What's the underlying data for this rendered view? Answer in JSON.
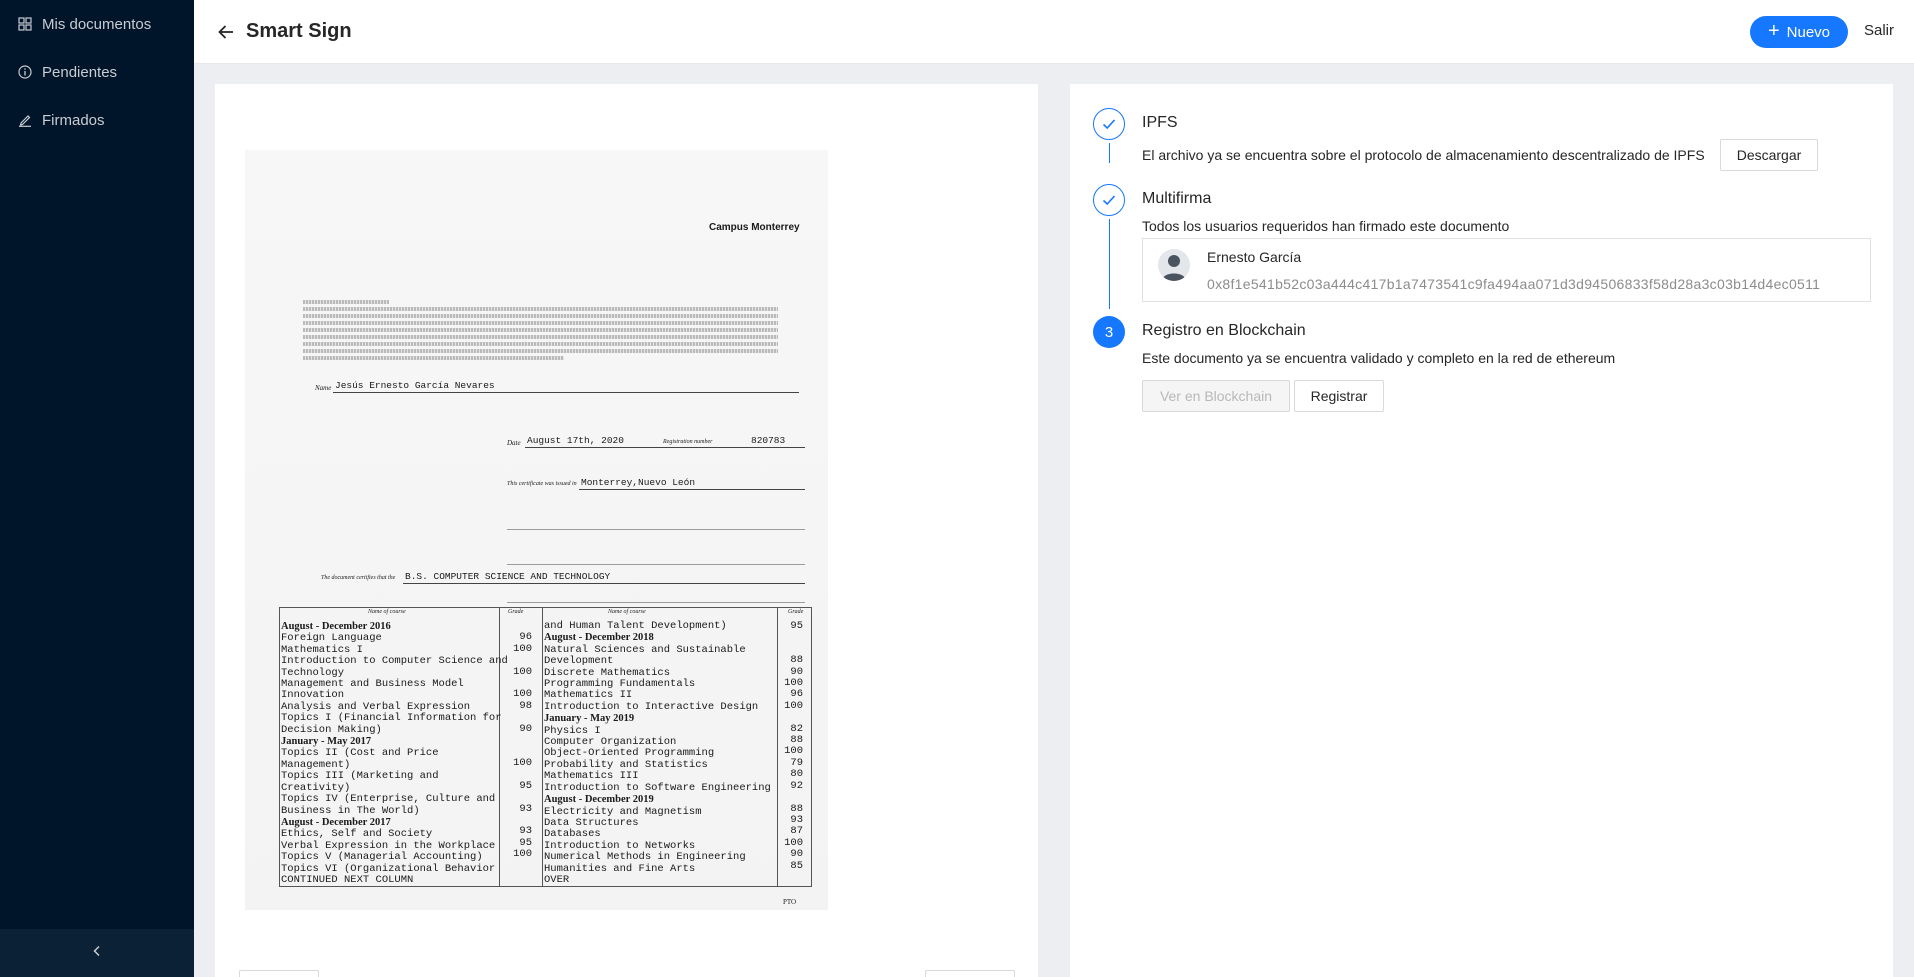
{
  "sidebar": {
    "items": [
      {
        "label": "Mis documentos",
        "icon": "grid-icon"
      },
      {
        "label": "Pendientes",
        "icon": "info-circle-icon"
      },
      {
        "label": "Firmados",
        "icon": "edit-icon"
      }
    ],
    "collapse_icon": "chevron-left-icon"
  },
  "header": {
    "title": "Smart Sign",
    "new_label": "Nuevo",
    "logout_label": "Salir"
  },
  "document": {
    "campus": "Campus Monterrey",
    "name_label": "Name",
    "name": "Jesús Ernesto García Nevares",
    "date_label": "Date",
    "date": "August 17th, 2020",
    "registration_label": "Registration number",
    "registration": "820783",
    "issued_label": "This certificate was issued in",
    "issued": "Monterrey,Nuevo León",
    "program_label": "The document certifies that the",
    "program": "B.S. COMPUTER SCIENCE AND TECHNOLOGY",
    "course_header": "Name of course",
    "grade_header": "Grade",
    "pto": "PTO",
    "left_column": [
      {
        "text": "August - December 2016",
        "grade": "",
        "term": true
      },
      {
        "text": "Foreign Language",
        "grade": "96",
        "term": false
      },
      {
        "text": "Mathematics I",
        "grade": "100",
        "term": false
      },
      {
        "text": "Introduction to Computer Science and",
        "grade": "",
        "term": false
      },
      {
        "text": "Technology",
        "grade": "100",
        "term": false
      },
      {
        "text": "Management and Business Model",
        "grade": "",
        "term": false
      },
      {
        "text": "Innovation",
        "grade": "100",
        "term": false
      },
      {
        "text": "Analysis and Verbal Expression",
        "grade": "98",
        "term": false
      },
      {
        "text": "Topics I (Financial Information for",
        "grade": "",
        "term": false
      },
      {
        "text": "Decision Making)",
        "grade": "90",
        "term": false
      },
      {
        "text": "January - May 2017",
        "grade": "",
        "term": true
      },
      {
        "text": "Topics II (Cost and Price",
        "grade": "",
        "term": false
      },
      {
        "text": "Management)",
        "grade": "100",
        "term": false
      },
      {
        "text": "Topics III (Marketing and",
        "grade": "",
        "term": false
      },
      {
        "text": "Creativity)",
        "grade": "95",
        "term": false
      },
      {
        "text": "Topics IV (Enterprise, Culture and",
        "grade": "",
        "term": false
      },
      {
        "text": "Business in The World)",
        "grade": "93",
        "term": false
      },
      {
        "text": "August - December 2017",
        "grade": "",
        "term": true
      },
      {
        "text": "Ethics, Self and Society",
        "grade": "93",
        "term": false
      },
      {
        "text": "Verbal Expression in the Workplace",
        "grade": "95",
        "term": false
      },
      {
        "text": "Topics V (Managerial Accounting)",
        "grade": "100",
        "term": false
      },
      {
        "text": "Topics VI (Organizational Behavior",
        "grade": "",
        "term": false
      },
      {
        "text": "CONTINUED NEXT COLUMN",
        "grade": "",
        "term": false
      }
    ],
    "right_column": [
      {
        "text": "and Human Talent Development)",
        "grade": "95",
        "term": false
      },
      {
        "text": "August - December 2018",
        "grade": "",
        "term": true
      },
      {
        "text": "Natural Sciences and Sustainable",
        "grade": "",
        "term": false
      },
      {
        "text": "Development",
        "grade": "88",
        "term": false
      },
      {
        "text": "Discrete Mathematics",
        "grade": "90",
        "term": false
      },
      {
        "text": "Programming Fundamentals",
        "grade": "100",
        "term": false
      },
      {
        "text": "Mathematics II",
        "grade": "96",
        "term": false
      },
      {
        "text": "Introduction to Interactive Design",
        "grade": "100",
        "term": false
      },
      {
        "text": "January - May 2019",
        "grade": "",
        "term": true
      },
      {
        "text": "Physics I",
        "grade": "82",
        "term": false
      },
      {
        "text": "Computer Organization",
        "grade": "88",
        "term": false
      },
      {
        "text": "Object-Oriented Programming",
        "grade": "100",
        "term": false
      },
      {
        "text": "Probability and Statistics",
        "grade": "79",
        "term": false
      },
      {
        "text": "Mathematics III",
        "grade": "80",
        "term": false
      },
      {
        "text": "Introduction to Software Engineering",
        "grade": "92",
        "term": false
      },
      {
        "text": "August - December 2019",
        "grade": "",
        "term": true
      },
      {
        "text": "Electricity and Magnetism",
        "grade": "88",
        "term": false
      },
      {
        "text": "Data Structures",
        "grade": "93",
        "term": false
      },
      {
        "text": "Databases",
        "grade": "87",
        "term": false
      },
      {
        "text": "Introduction to Networks",
        "grade": "100",
        "term": false
      },
      {
        "text": "Numerical Methods in Engineering",
        "grade": "90",
        "term": false
      },
      {
        "text": "Humanities and Fine Arts",
        "grade": "85",
        "term": false
      },
      {
        "text": "OVER",
        "grade": "",
        "term": false
      }
    ]
  },
  "steps": [
    {
      "title": "IPFS",
      "description": "El archivo ya se encuentra sobre el protocolo de almacenamiento descentralizado de IPFS",
      "button": "Descargar",
      "status": "done"
    },
    {
      "title": "Multifirma",
      "description": "Todos los usuarios requeridos han firmado este documento",
      "status": "done",
      "signer": {
        "name": "Ernesto García",
        "address": "0x8f1e541b52c03a444c417b1a7473541c9fa494aa071d3d94506833f58d28a3c03b14d4ec0511"
      }
    },
    {
      "title": "Registro en Blockchain",
      "number": "3",
      "description": "Este documento ya se encuentra validado y completo en la red de ethereum",
      "view_button": "Ver en Blockchain",
      "register_button": "Registrar",
      "status": "active"
    }
  ],
  "colors": {
    "sidebar_bg": "#001529",
    "primary": "#1677ff",
    "page_bg": "#eceef1"
  }
}
